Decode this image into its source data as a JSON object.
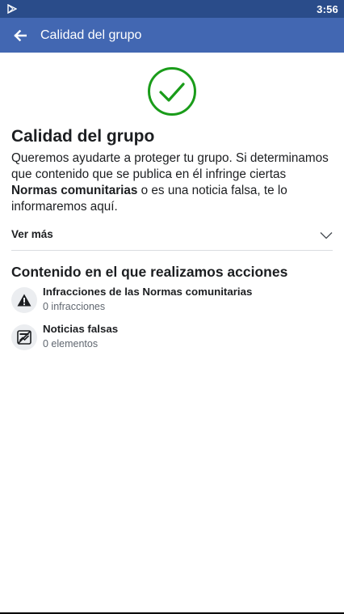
{
  "status_bar": {
    "time": "3:56"
  },
  "app_bar": {
    "title": "Calidad del grupo"
  },
  "main": {
    "title": "Calidad del grupo",
    "description_part1": "Queremos ayudarte a proteger tu grupo. Si determinamos que contenido que se publica en él infringe ciertas ",
    "description_bold": "Normas comunitarias",
    "description_part2": " o es una noticia falsa, te lo informaremos aquí.",
    "see_more": "Ver más",
    "actions_title": "Contenido en el que realizamos acciones",
    "actions": [
      {
        "label": "Infracciones de las Normas comunitarias",
        "sub": "0 infracciones",
        "icon": "warning-icon"
      },
      {
        "label": "Noticias falsas",
        "sub": "0 elementos",
        "icon": "false-news-icon"
      }
    ]
  },
  "colors": {
    "status_bar": "#2a4c8a",
    "app_bar": "#4267b2",
    "success_green": "#1a9c1a"
  }
}
